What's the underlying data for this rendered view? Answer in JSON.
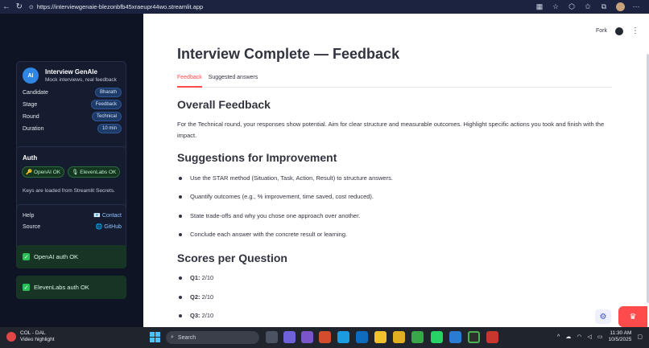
{
  "browser": {
    "url": "https://interviewgenaie-blezonbfb45xraeupr44wo.streamlit.app"
  },
  "sidebar": {
    "app_badge": "AI",
    "app_name": "Interview GenAIe",
    "tagline": "Mock interviews, real feedback",
    "info_rows": [
      {
        "label": "Candidate",
        "value": "Bharath"
      },
      {
        "label": "Stage",
        "value": "Feedback"
      },
      {
        "label": "Round",
        "value": "Technical"
      },
      {
        "label": "Duration",
        "value": "10 min"
      }
    ],
    "auth": {
      "title": "Auth",
      "chips": [
        "🔑 OpenAI OK",
        "🎙 ElevenLabs OK"
      ],
      "note": "Keys are loaded from Streamlit Secrets."
    },
    "links": [
      {
        "label": "Help",
        "value": "📧 Contact"
      },
      {
        "label": "Source",
        "value": "🌐 GitHub"
      }
    ],
    "status": [
      "OpenAI auth OK",
      "ElevenLabs auth OK"
    ]
  },
  "main": {
    "topbar": {
      "fork": "Fork"
    },
    "title": "Interview Complete — Feedback",
    "tabs": [
      "Feedback",
      "Suggested answers"
    ],
    "overall": {
      "heading": "Overall Feedback",
      "text": "For the Technical round, your responses show potential. Aim for clear structure and measurable outcomes. Highlight specific actions you took and finish with the impact."
    },
    "suggestions": {
      "heading": "Suggestions for Improvement",
      "items": [
        "Use the STAR method (Situation, Task, Action, Result) to structure answers.",
        "Quantify outcomes (e.g., % improvement, time saved, cost reduced).",
        "State trade-offs and why you chose one approach over another.",
        "Conclude each answer with the concrete result or learning."
      ]
    },
    "scores": {
      "heading": "Scores per Question",
      "items": [
        {
          "label": "Q1:",
          "value": "2/10"
        },
        {
          "label": "Q2:",
          "value": "2/10"
        },
        {
          "label": "Q3:",
          "value": "2/10"
        }
      ]
    }
  },
  "taskbar": {
    "weather_title": "COL - DAL",
    "weather_sub": "Video highlight",
    "search_placeholder": "Search",
    "time": "11:30 AM",
    "date": "10/5/2025"
  }
}
